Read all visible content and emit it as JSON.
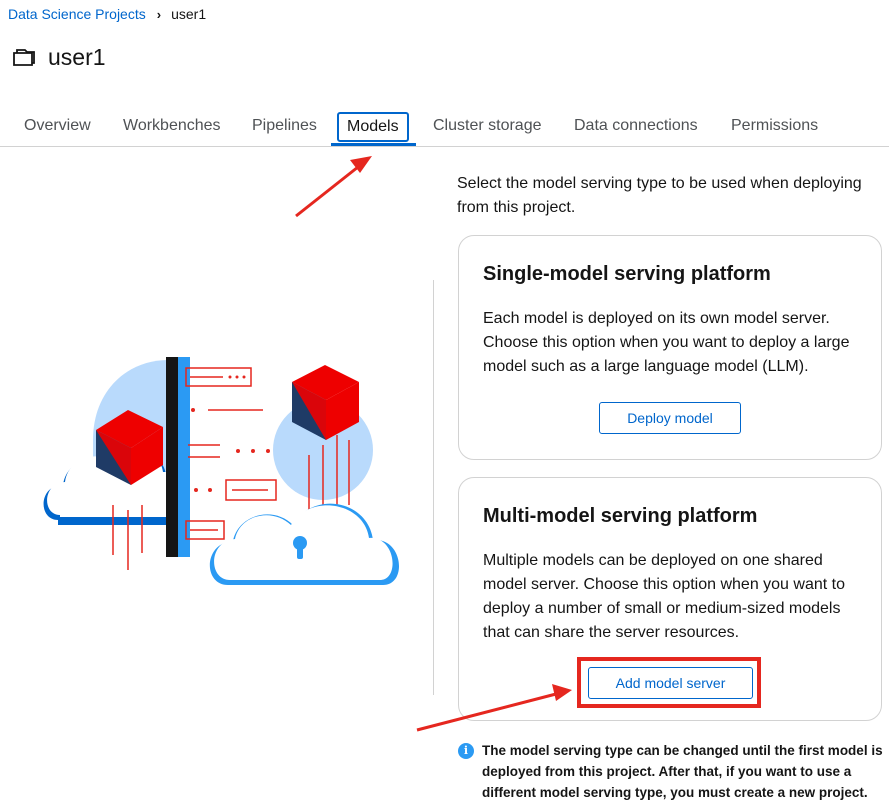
{
  "breadcrumb": {
    "parent": "Data Science Projects",
    "current": "user1"
  },
  "page": {
    "title": "user1"
  },
  "tabs": [
    {
      "label": "Overview",
      "active": false
    },
    {
      "label": "Workbenches",
      "active": false
    },
    {
      "label": "Pipelines",
      "active": false
    },
    {
      "label": "Models",
      "active": true
    },
    {
      "label": "Cluster storage",
      "active": false
    },
    {
      "label": "Data connections",
      "active": false
    },
    {
      "label": "Permissions",
      "active": false
    }
  ],
  "models": {
    "intro": "Select the model serving type to be used when deploying from this project.",
    "single": {
      "title": "Single-model serving platform",
      "description": "Each model is deployed on its own model server. Choose this option when you want to deploy a large model such as a large language model (LLM).",
      "button": "Deploy model"
    },
    "multi": {
      "title": "Multi-model serving platform",
      "description": "Multiple models can be deployed on one shared model server. Choose this option when you want to deploy a number of small or medium-sized models that can share the server resources.",
      "button": "Add model server"
    },
    "info": "The model serving type can be changed until the first model is deployed from this project. After that, if you want to use a different model serving type, you must create a new project."
  },
  "icons": {
    "project": "folder-icon",
    "breadcrumb_separator": "chevron-right-icon",
    "info": "info-circle-icon"
  },
  "colors": {
    "link": "#0066cc",
    "annotation": "#e5271f",
    "info": "#2b9af3"
  }
}
